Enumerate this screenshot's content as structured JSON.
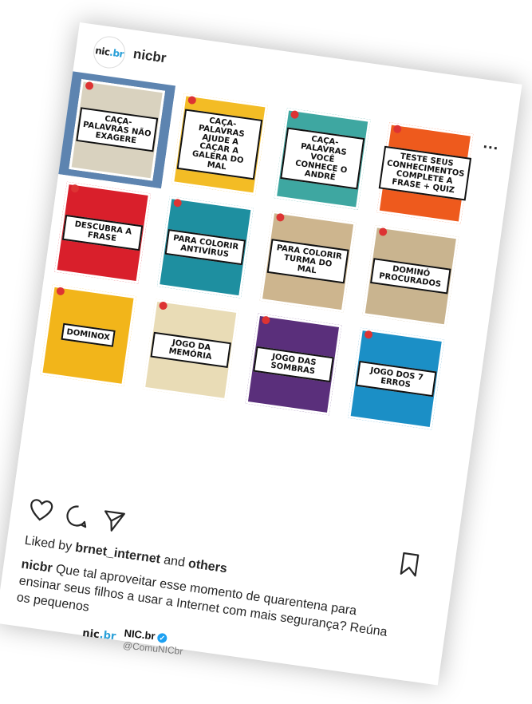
{
  "post": {
    "avatar_logo_main": "nic",
    "avatar_logo_accent": ".br",
    "username": "nicbr",
    "more": "...",
    "likes_prefix": "Liked by ",
    "likes_user": "brnet_internet",
    "likes_and": " and ",
    "likes_others": "others",
    "caption_user": "nicbr",
    "caption_text": " Que tal aproveitar esse momento de quarentena para ensinar seus filhos a usar a Internet com mais segurança? Reúna os pequenos"
  },
  "tiles": [
    {
      "bg": "#5d84b0",
      "poster": "#d9d2bf",
      "label": "CAÇA-PALAVRAS NÃO EXAGERE"
    },
    {
      "bg": "#ffffff",
      "poster": "#f3bc25",
      "label": "CAÇA-PALAVRAS AJUDE A CAÇAR A GALERA DO MAL"
    },
    {
      "bg": "#ffffff",
      "poster": "#3ea7a1",
      "label": "CAÇA-PALAVRAS VOCÊ CONHECE O ANDRÉ"
    },
    {
      "bg": "#ffffff",
      "poster": "#ee5a1d",
      "label": "TESTE SEUS CONHECIMENTOS COMPLETE A FRASE + QUIZ"
    },
    {
      "bg": "#ffffff",
      "poster": "#d91f2b",
      "label": "DESCUBRA A FRASE"
    },
    {
      "bg": "#ffffff",
      "poster": "#1e8fa0",
      "label": "PARA COLORIR ANTIVÍRUS"
    },
    {
      "bg": "#ffffff",
      "poster": "#cdb58e",
      "label": "PARA COLORIR TURMA DO MAL"
    },
    {
      "bg": "#ffffff",
      "poster": "#c9b48f",
      "label": "DOMINÓ PROCURADOS"
    },
    {
      "bg": "#ffffff",
      "poster": "#f2b51a",
      "label": "DOMINOX"
    },
    {
      "bg": "#ffffff",
      "poster": "#e9dcb6",
      "label": "JOGO DA MEMÓRIA"
    },
    {
      "bg": "#ffffff",
      "poster": "#5a2f7b",
      "label": "JOGO DAS SOMBRAS"
    },
    {
      "bg": "#ffffff",
      "poster": "#1b8fc6",
      "label": "JOGO DOS 7 ERROS"
    },
    {
      "bg": "#ffffff",
      "poster": "#ffffff",
      "label": ""
    },
    {
      "bg": "#ffffff",
      "poster": "#ffffff",
      "label": ""
    },
    {
      "bg": "#ffffff",
      "poster": "#ffffff",
      "label": ""
    },
    {
      "bg": "#ffffff",
      "poster": "#ffffff",
      "label": ""
    }
  ],
  "tweet": {
    "logo_main": "nic",
    "logo_accent": ".br",
    "name": "NIC.br",
    "handle": "@ComuNICbr"
  }
}
